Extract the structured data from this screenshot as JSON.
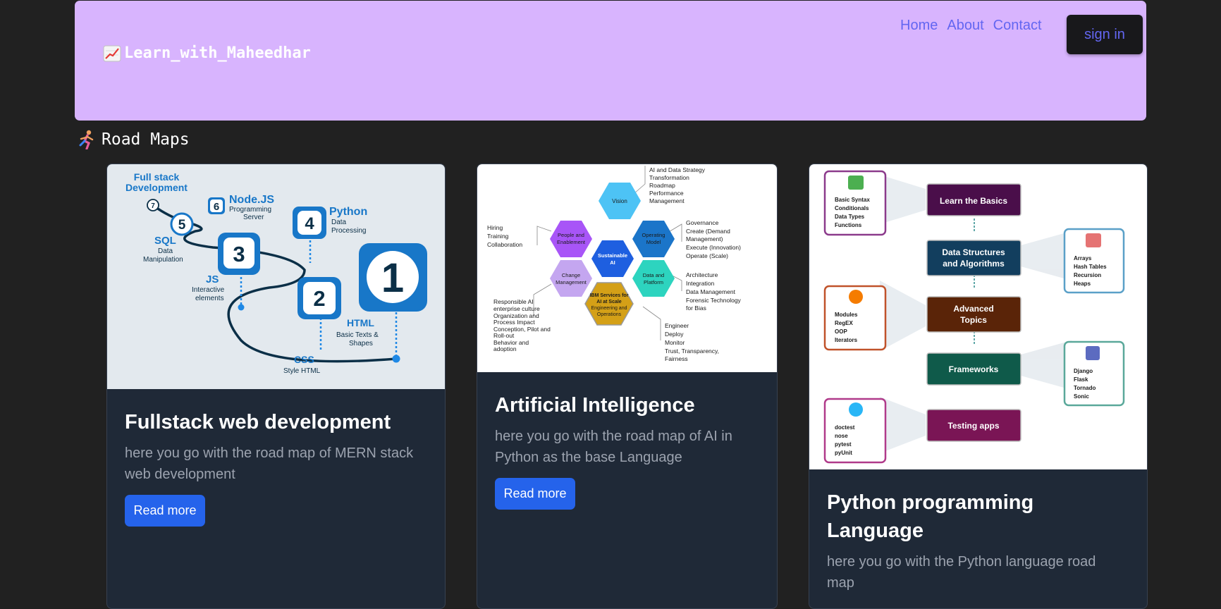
{
  "header": {
    "brand": "Learn_with_Maheedhar",
    "nav": [
      "Home",
      "About",
      "Contact"
    ],
    "signin_label": "sign in"
  },
  "section": {
    "title": "Road Maps"
  },
  "cards": [
    {
      "title": "Fullstack web development",
      "desc": "here you go with the road map of MERN stack web development",
      "button": "Read more",
      "image": {
        "labels": [
          "Full stack Development",
          "Node.JS",
          "Programming Server",
          "Python",
          "Data Processing",
          "SQL",
          "Data Manipulation",
          "JS",
          "Interactive elements",
          "HTML",
          "Basic Texts & Shapes",
          "CSS",
          "Style HTML"
        ],
        "steps": [
          "7",
          "6",
          "5",
          "4",
          "3",
          "2",
          "1"
        ]
      }
    },
    {
      "title": "Artificial Intelligence",
      "desc": "here you go with the road map of AI in Python as the base Language",
      "button": "Read more",
      "image": {
        "hexes": [
          "Vision",
          "People and Enablement",
          "Operating Model",
          "Sustainable AI",
          "Change Management",
          "Data and Platform",
          "IBM Services for AI at Scale",
          "Engineering and Operations"
        ],
        "lists": [
          [
            "AI and Data Strategy",
            "Transformation Roadmap",
            "Performance Management"
          ],
          [
            "Hiring",
            "Training",
            "Collaboration"
          ],
          [
            "Governance",
            "Create (Demand Management)",
            "Execute (Innovation)",
            "Operate (Scale)"
          ],
          [
            "Architecture",
            "Integration",
            "Data Management",
            "Forensic Technology for Bias"
          ],
          [
            "Responsible AI enterprise culture",
            "Organization and Process Impact",
            "Conception, Pilot and Roll-out",
            "Behavior and adoption"
          ],
          [
            "Engineer",
            "Deploy",
            "Monitor",
            "Trust, Transparency, Fairness"
          ]
        ]
      }
    },
    {
      "title": "Python programming Language",
      "desc": "here you go with the Python language road map",
      "button": "Read more",
      "image": {
        "steps": [
          "Learn the Basics",
          "Data Structures and Algorithms",
          "Advanced Topics",
          "Frameworks",
          "Testing apps"
        ],
        "left_lists": [
          [
            "Basic Syntax",
            "Conditionals",
            "Data Types",
            "Functions"
          ],
          [
            "Modules",
            "RegEX",
            "OOP",
            "Iterators"
          ],
          [
            "doctest",
            "nose",
            "pytest",
            "pyUnit"
          ]
        ],
        "right_lists": [
          [
            "Arrays",
            "Hash Tables",
            "Recursion",
            "Heaps"
          ],
          [
            "Django",
            "Flask",
            "Tornado",
            "Sonic"
          ]
        ]
      }
    }
  ],
  "colors": {
    "page_bg": "#212121",
    "header_bg": "#d8b4fe",
    "nav_link": "#6366f1",
    "card_bg": "#1f2937",
    "button": "#2563eb"
  },
  "icons": [
    "chart-increasing-icon",
    "runner-icon"
  ]
}
